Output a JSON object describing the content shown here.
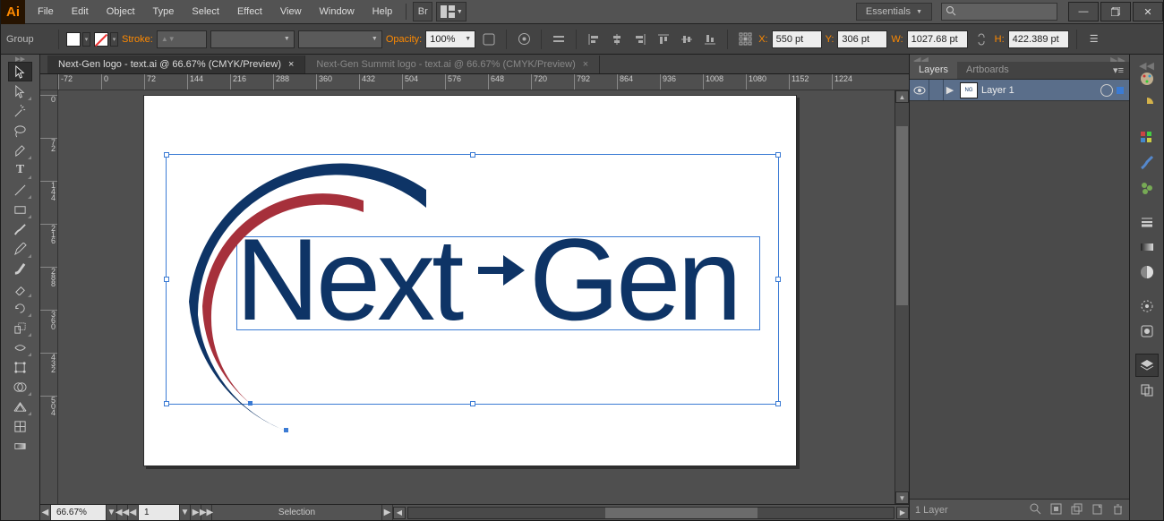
{
  "app": {
    "badge": "Ai"
  },
  "menu": [
    "File",
    "Edit",
    "Object",
    "Type",
    "Select",
    "Effect",
    "View",
    "Window",
    "Help"
  ],
  "workspace": "Essentials",
  "search_placeholder": "",
  "ctrl": {
    "selection": "Group",
    "stroke_label": "Stroke:",
    "opacity_label": "Opacity:",
    "opacity_value": "100%",
    "x_label": "X:",
    "x_value": "550 pt",
    "y_label": "Y:",
    "y_value": "306 pt",
    "w_label": "W:",
    "w_value": "1027.68 pt",
    "h_label": "H:",
    "h_value": "422.389 pt"
  },
  "tabs": [
    {
      "title": "Next-Gen logo - text.ai @ 66.67% (CMYK/Preview)",
      "close": "×",
      "active": true
    },
    {
      "title": "Next-Gen Summit logo - text.ai @ 66.67% (CMYK/Preview)",
      "close": "×",
      "active": false
    }
  ],
  "ruler_h": [
    "-72",
    "0",
    "72",
    "144",
    "216",
    "288",
    "360",
    "432",
    "504",
    "576",
    "648",
    "720",
    "792",
    "864",
    "936",
    "1008",
    "1080",
    "1152",
    "1224"
  ],
  "ruler_v": [
    "0",
    "72",
    "144",
    "216",
    "288",
    "360",
    "432",
    "504"
  ],
  "artwork": {
    "text_next": "Next",
    "text_gen": "Gen",
    "navy": "#0e3466",
    "red": "#a6303b"
  },
  "right": {
    "tabs": [
      "Layers",
      "Artboards"
    ],
    "layer_name": "Layer 1",
    "footer": "1 Layer"
  },
  "status": {
    "zoom": "66.67%",
    "artboard": "1",
    "tool": "Selection"
  }
}
